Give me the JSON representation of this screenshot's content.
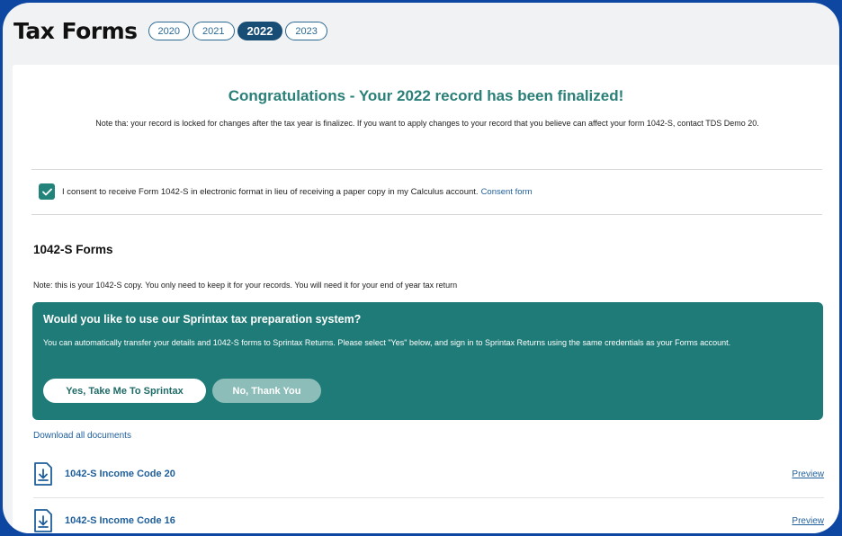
{
  "header": {
    "title": "Tax Forms",
    "years": [
      "2020",
      "2021",
      "2022",
      "2023"
    ],
    "selected_year": "2022"
  },
  "congrats": {
    "title": "Congratulations - Your 2022 record has been finalized!",
    "note": "Note tha: your record is locked for changes after the tax year is finalizec. If you want to apply changes to your record that you believe can affect your form 1042-S, contact TDS Demo 20."
  },
  "consent": {
    "checked": true,
    "text": "I consent to receive Form 1042-S in electronic format in lieu of receiving a paper copy in my Calculus account.",
    "link_label": "Consent form"
  },
  "forms_section": {
    "title": "1042-S Forms",
    "note": "Note: this is your 1042-S copy. You only need to keep it for your records. You will need it for your end of year tax return"
  },
  "sprintax_banner": {
    "title": "Would you like to use our Sprintax tax preparation system?",
    "text": "You can automatically transfer your details and 1042-S forms to Sprintax Returns. Please select \"Yes\" below, and sign in to Sprintax Returns using the same credentials as your Forms account.",
    "yes_label": "Yes, Take Me To Sprintax",
    "no_label": "No, Thank You"
  },
  "download_all_label": "Download all documents",
  "documents": [
    {
      "name": "1042-S Income Code 20",
      "action": "Preview"
    },
    {
      "name": "1042-S Income Code 16",
      "action": "Preview"
    }
  ],
  "colors": {
    "accent_teal": "#1f7b77",
    "link_blue": "#1e5e9a",
    "year_active": "#184d76",
    "frame_blue": "#0d47a1"
  },
  "icons": {
    "checkbox": "check-icon",
    "document": "document-download-icon"
  }
}
